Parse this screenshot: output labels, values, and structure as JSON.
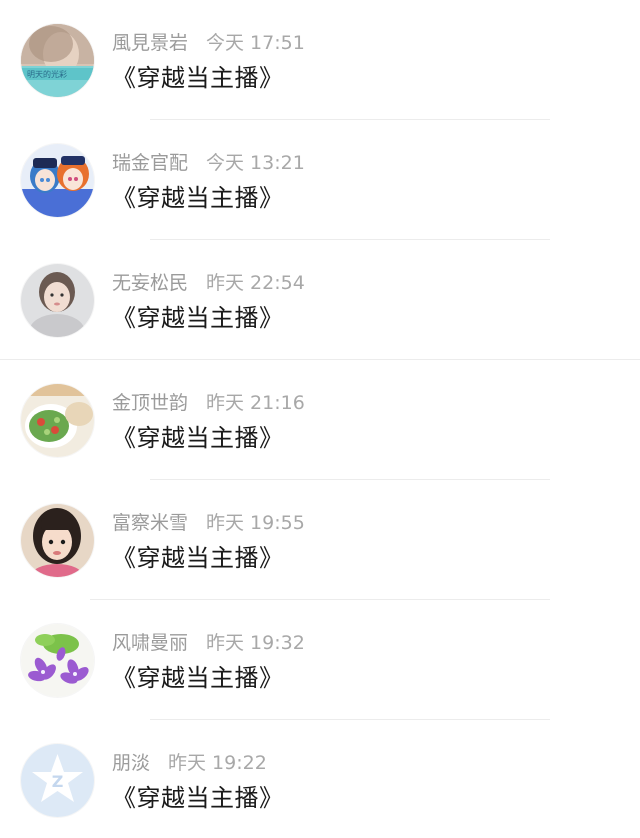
{
  "messages": [
    {
      "sender": "風見景岩",
      "time": "今天 17:51",
      "text": "《穿越当主播》",
      "avatar": "girl-blurred-photo-avatar"
    },
    {
      "sender": "瑞金官配",
      "time": "今天 13:21",
      "text": "《穿越当主播》",
      "avatar": "anime-characters-avatar"
    },
    {
      "sender": "无妄松民",
      "time": "昨天 22:54",
      "text": "《穿越当主播》",
      "avatar": "girl-portrait-avatar"
    },
    {
      "sender": "金顶世韵",
      "time": "昨天 21:16",
      "text": "《穿越当主播》",
      "avatar": "salad-food-avatar"
    },
    {
      "sender": "富察米雪",
      "time": "昨天 19:55",
      "text": "《穿越当主播》",
      "avatar": "child-portrait-avatar"
    },
    {
      "sender": "风啸曼丽",
      "time": "昨天 19:32",
      "text": "《穿越当主播》",
      "avatar": "purple-flowers-avatar"
    },
    {
      "sender": "朋淡",
      "time": "昨天 19:22",
      "text": "《穿越当主播》",
      "avatar": "default-qq-avatar"
    }
  ],
  "colors": {
    "sender": "#9b9b9b",
    "message": "#1a1a1a",
    "divider": "#ececec",
    "background": "#ffffff"
  }
}
